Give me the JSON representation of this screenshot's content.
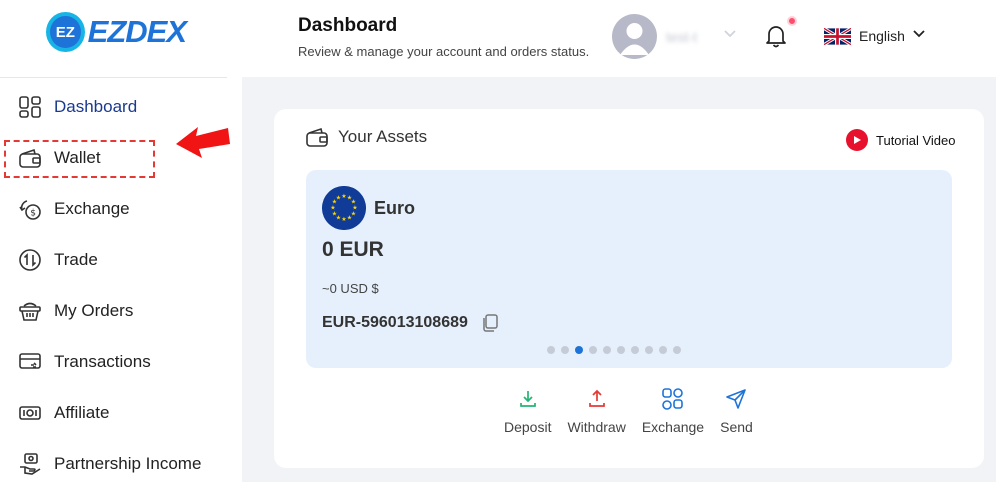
{
  "brand": {
    "name": "EZDEX",
    "mark": "EZ"
  },
  "header": {
    "title": "Dashboard",
    "subtitle": "Review & manage your account and orders status.",
    "user_name": "test-t",
    "language": "English"
  },
  "sidebar": {
    "items": [
      {
        "id": "dashboard",
        "label": "Dashboard",
        "icon": "dashboard-grid-icon",
        "active": true
      },
      {
        "id": "wallet",
        "label": "Wallet",
        "icon": "wallet-icon",
        "active": false
      },
      {
        "id": "exchange",
        "label": "Exchange",
        "icon": "exchange-coins-icon",
        "active": false
      },
      {
        "id": "trade",
        "label": "Trade",
        "icon": "trade-arrows-icon",
        "active": false
      },
      {
        "id": "my-orders",
        "label": "My Orders",
        "icon": "orders-basket-icon",
        "active": false
      },
      {
        "id": "transactions",
        "label": "Transactions",
        "icon": "transactions-card-icon",
        "active": false
      },
      {
        "id": "affiliate",
        "label": "Affiliate",
        "icon": "affiliate-cash-icon",
        "active": false
      },
      {
        "id": "partnership-income",
        "label": "Partnership Income",
        "icon": "partnership-hand-icon",
        "active": false
      }
    ]
  },
  "assets": {
    "title": "Your Assets",
    "tutorial_label": "Tutorial Video",
    "currency": {
      "name": "Euro",
      "balance": "0 EUR",
      "usd_balance": "~0 USD $",
      "account_id": "EUR-596013108689"
    },
    "carousel": {
      "total": 10,
      "active_index": 2
    },
    "actions": [
      {
        "id": "deposit",
        "label": "Deposit",
        "icon": "deposit-download-icon",
        "color": "#22b573"
      },
      {
        "id": "withdraw",
        "label": "Withdraw",
        "icon": "withdraw-upload-icon",
        "color": "#e53935"
      },
      {
        "id": "exchange",
        "label": "Exchange",
        "icon": "exchange-grid-icon",
        "color": "#1e73d8"
      },
      {
        "id": "send",
        "label": "Send",
        "icon": "send-plane-icon",
        "color": "#1e73d8"
      }
    ]
  },
  "colors": {
    "accent": "#1e73d8",
    "highlight": "#e53935",
    "card_bg": "#e6f0fc",
    "main_bg": "#f2f3f7"
  }
}
